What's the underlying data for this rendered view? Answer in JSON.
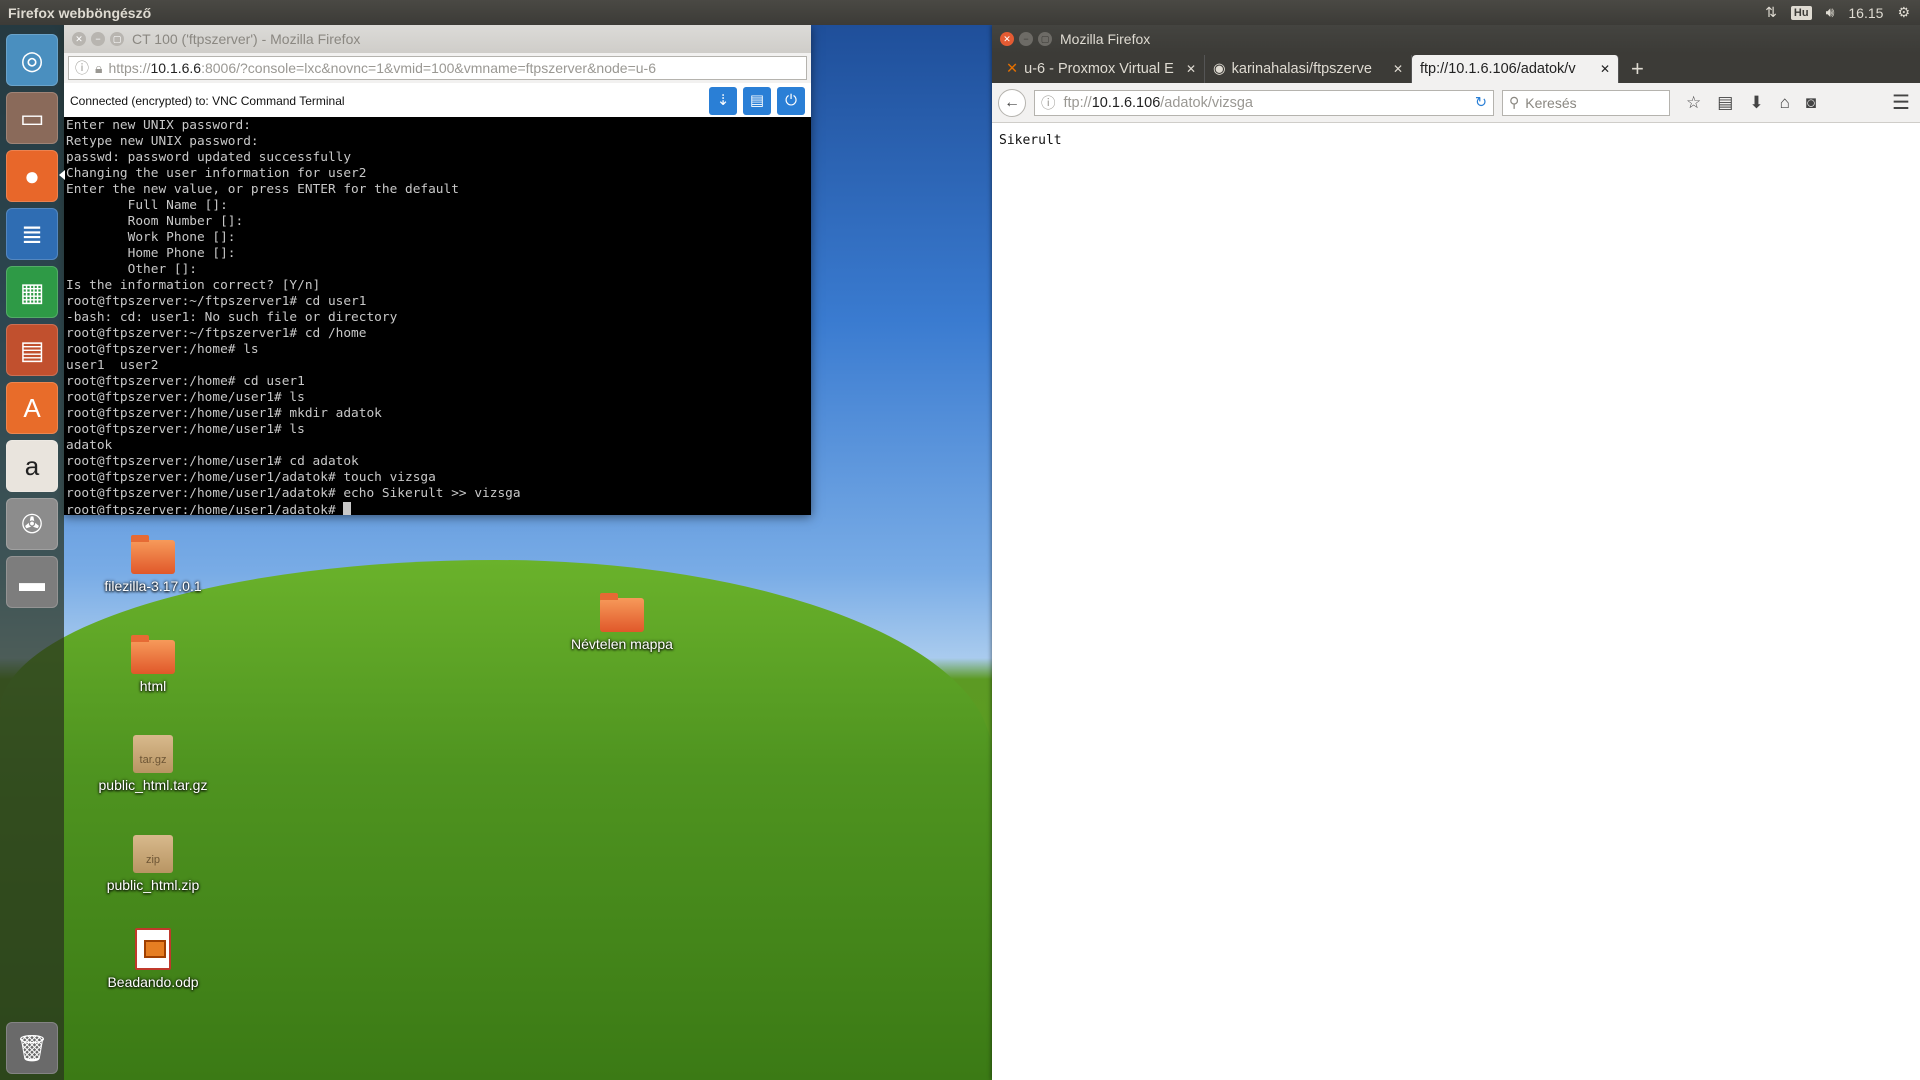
{
  "top_panel": {
    "app_title": "Firefox webböngésző",
    "keyboard_layout": "Hu",
    "clock": "16.15"
  },
  "launcher": {
    "items": [
      "dash-home",
      "files",
      "firefox",
      "libreoffice-writer",
      "libreoffice-calc",
      "libreoffice-impress",
      "ubuntu-software",
      "amazon",
      "system-settings",
      "disk"
    ],
    "trash": "trash"
  },
  "desktop": {
    "icons": [
      {
        "label": "filezilla-3.17.0.1",
        "type": "folder"
      },
      {
        "label": "html",
        "type": "folder"
      },
      {
        "label": "public_html.tar.gz",
        "type": "archive",
        "badge": "tar.gz"
      },
      {
        "label": "public_html.zip",
        "type": "archive",
        "badge": "zip"
      },
      {
        "label": "Beadando.odp",
        "type": "presentation"
      },
      {
        "label": "Névtelen mappa",
        "type": "folder"
      }
    ]
  },
  "vnc_window": {
    "title": "CT 100 ('ftpszerver') - Mozilla Firefox",
    "url_prefix": "https://",
    "url_host": "10.1.6.6",
    "url_rest": ":8006/?console=lxc&novnc=1&vmid=100&vmname=ftpszerver&node=u-6",
    "status": "Connected (encrypted) to: VNC Command Terminal",
    "terminal_lines": [
      "Enter new UNIX password:",
      "Retype new UNIX password:",
      "passwd: password updated successfully",
      "Changing the user information for user2",
      "Enter the new value, or press ENTER for the default",
      "        Full Name []:",
      "        Room Number []:",
      "        Work Phone []:",
      "        Home Phone []:",
      "        Other []:",
      "Is the information correct? [Y/n]",
      "root@ftpszerver:~/ftpszerver1# cd user1",
      "-bash: cd: user1: No such file or directory",
      "root@ftpszerver:~/ftpszerver1# cd /home",
      "root@ftpszerver:/home# ls",
      "user1  user2",
      "root@ftpszerver:/home# cd user1",
      "root@ftpszerver:/home/user1# ls",
      "root@ftpszerver:/home/user1# mkdir adatok",
      "root@ftpszerver:/home/user1# ls",
      "adatok",
      "root@ftpszerver:/home/user1# cd adatok",
      "root@ftpszerver:/home/user1/adatok# touch vizsga",
      "root@ftpszerver:/home/user1/adatok# echo Sikerult >> vizsga"
    ],
    "prompt": "root@ftpszerver:/home/user1/adatok# "
  },
  "ff_window": {
    "title": "Mozilla Firefox",
    "tabs": [
      {
        "label": "u-6 - Proxmox Virtual E",
        "active": false
      },
      {
        "label": "karinahalasi/ftpszerve",
        "active": false
      },
      {
        "label": "ftp://10.1.6.106/adatok/v",
        "active": true
      }
    ],
    "url_prefix": "ftp://",
    "url_host": "10.1.6.106",
    "url_rest": "/adatok/vizsga",
    "search_placeholder": "Keresés",
    "page_text": "Sikerult"
  },
  "colors": {
    "accent_blue": "#2a7fd6",
    "close_orange": "#e45b33",
    "panel_dark": "#3c3b37"
  }
}
